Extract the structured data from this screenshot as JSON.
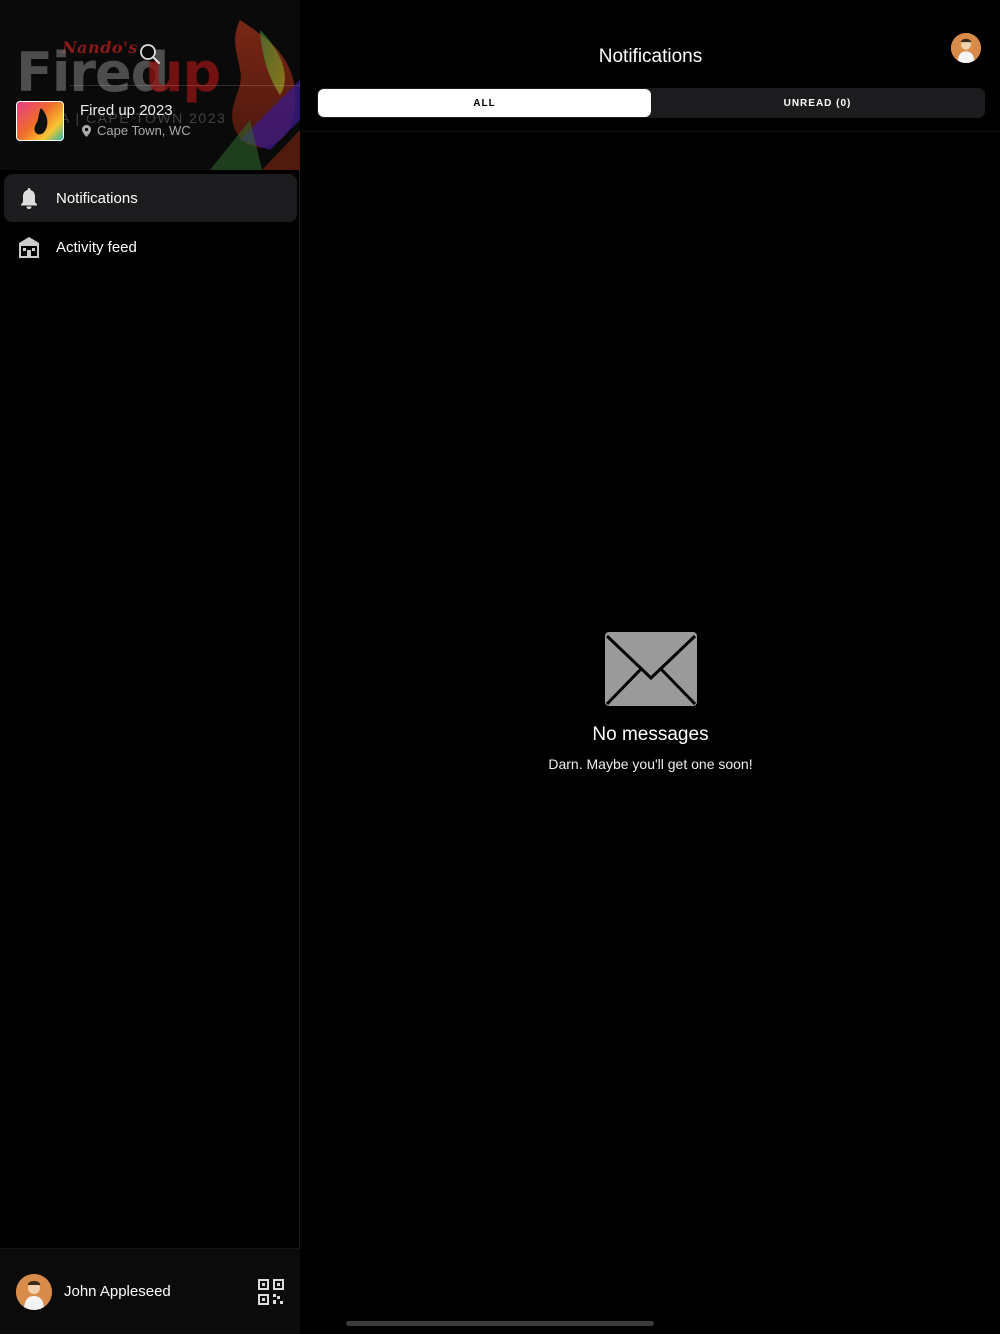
{
  "sidebar": {
    "banner": {
      "brand_small": "Nando's",
      "brand_fired": "Fired",
      "brand_up": "up",
      "brand_tag": "A | CAPE TOWN 2023"
    },
    "event": {
      "title": "Fired up 2023",
      "location": "Cape Town, WC"
    },
    "nav": [
      {
        "label": "Notifications",
        "icon": "bell-icon",
        "active": true
      },
      {
        "label": "Activity feed",
        "icon": "building-icon",
        "active": false
      }
    ],
    "user": {
      "name": "John Appleseed"
    }
  },
  "main": {
    "title": "Notifications",
    "tabs": [
      {
        "label": "ALL",
        "selected": true
      },
      {
        "label": "UNREAD (0)",
        "selected": false
      }
    ],
    "empty_state": {
      "icon": "envelope-icon",
      "title": "No messages",
      "subtitle": "Darn. Maybe you'll get one soon!"
    }
  },
  "colors": {
    "background": "#000000",
    "surface": "#1c1c1e",
    "accent_red": "#8a1a1a"
  }
}
